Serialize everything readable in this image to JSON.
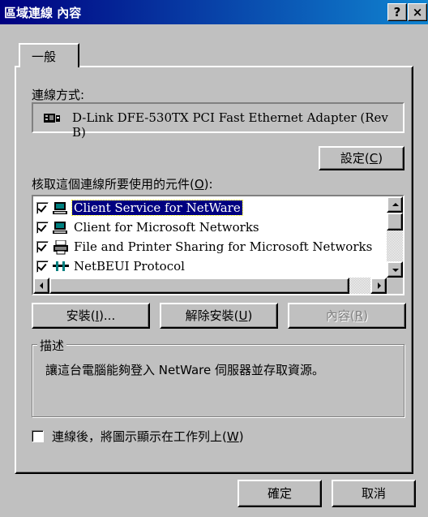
{
  "window": {
    "title": "區域連線 內容",
    "help_button": "?",
    "close_button": "×"
  },
  "tabs": [
    {
      "label": "一般"
    }
  ],
  "connect_using": {
    "label": "連線方式:",
    "adapter": "D-Link DFE-530TX PCI Fast Ethernet Adapter (Rev B)",
    "configure_button": "設定(",
    "configure_key": "C",
    "configure_close": ")"
  },
  "components": {
    "label": "核取這個連線所要使用的元件(",
    "label_key": "O",
    "label_close": "):",
    "items": [
      {
        "label": "Client Service for NetWare",
        "checked": true,
        "selected": true,
        "icon": "network-client-icon"
      },
      {
        "label": "Client for Microsoft Networks",
        "checked": true,
        "selected": false,
        "icon": "network-client-icon"
      },
      {
        "label": "File and Printer Sharing for Microsoft Networks",
        "checked": true,
        "selected": false,
        "icon": "printer-sharing-icon"
      },
      {
        "label": "NetBEUI Protocol",
        "checked": true,
        "selected": false,
        "icon": "protocol-icon"
      }
    ]
  },
  "actions": {
    "install": {
      "label": "安裝(",
      "key": "I",
      "close": ")..."
    },
    "uninstall": {
      "label": "解除安裝(",
      "key": "U",
      "close": ")"
    },
    "properties": {
      "label": "內容(",
      "key": "R",
      "close": ")",
      "disabled": true
    }
  },
  "description": {
    "title": "描述",
    "text": "讓這台電腦能夠登入 NetWare 伺服器並存取資源。"
  },
  "show_icon": {
    "label": "連線後，將圖示顯示在工作列上(",
    "key": "W",
    "close": ")",
    "checked": false
  },
  "footer": {
    "ok": "確定",
    "cancel": "取消"
  }
}
